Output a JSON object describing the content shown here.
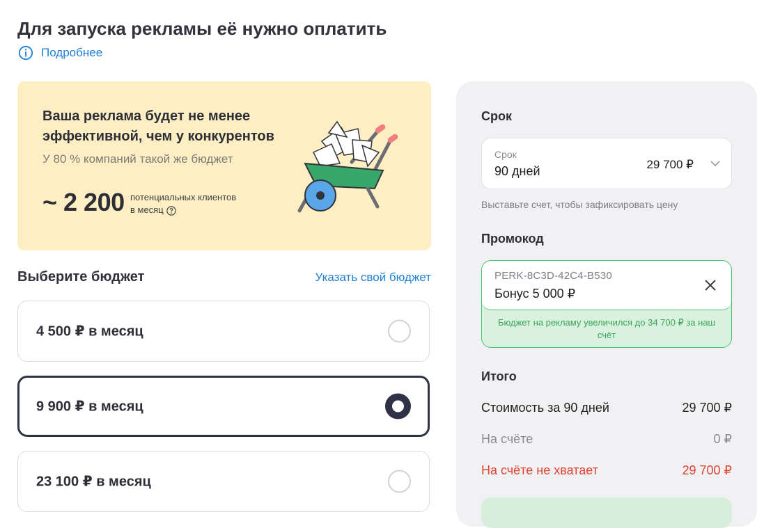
{
  "header": {
    "title": "Для запуска рекламы её нужно оплатить",
    "more_link": "Подробнее"
  },
  "promo": {
    "headline": "Ваша реклама будет не менее эффективной, чем у конкурентов",
    "subtext": "У 80 % компаний такой же бюджет",
    "count": "~ 2 200",
    "count_label_line1": "потенциальных клиентов",
    "count_label_line2": "в месяц"
  },
  "budget": {
    "heading": "Выберите бюджет",
    "custom_link": "Указать свой бюджет",
    "options": [
      {
        "label": "4 500 ₽ в месяц",
        "selected": false
      },
      {
        "label": "9 900 ₽ в месяц",
        "selected": true
      },
      {
        "label": "23 100 ₽ в месяц",
        "selected": false
      }
    ]
  },
  "sidebar": {
    "term_heading": "Срок",
    "term_caption": "Срок",
    "term_value": "90 дней",
    "term_price": "29 700 ₽",
    "hint": "Выставьте счет, чтобы зафиксировать цену",
    "promo_heading": "Промокод",
    "promo_code": "PERK-8C3D-42C4-B530",
    "promo_bonus": "Бонус 5 000 ₽",
    "promo_message": "Бюджет на рекламу увеличился до 34 700 ₽ за наш счёт",
    "total_heading": "Итого",
    "rows": [
      {
        "label": "Стоимость за 90 дней",
        "value": "29 700 ₽"
      },
      {
        "label": "На счёте",
        "value": "0 ₽"
      },
      {
        "label": "На счёте не хватает",
        "value": "29 700 ₽"
      }
    ]
  },
  "colors": {
    "accent_link": "#1f7fd6",
    "promo_bg": "#fdefc3",
    "success": "#4bbf6b",
    "danger": "#e0432f",
    "selected_border": "#2f3144"
  }
}
